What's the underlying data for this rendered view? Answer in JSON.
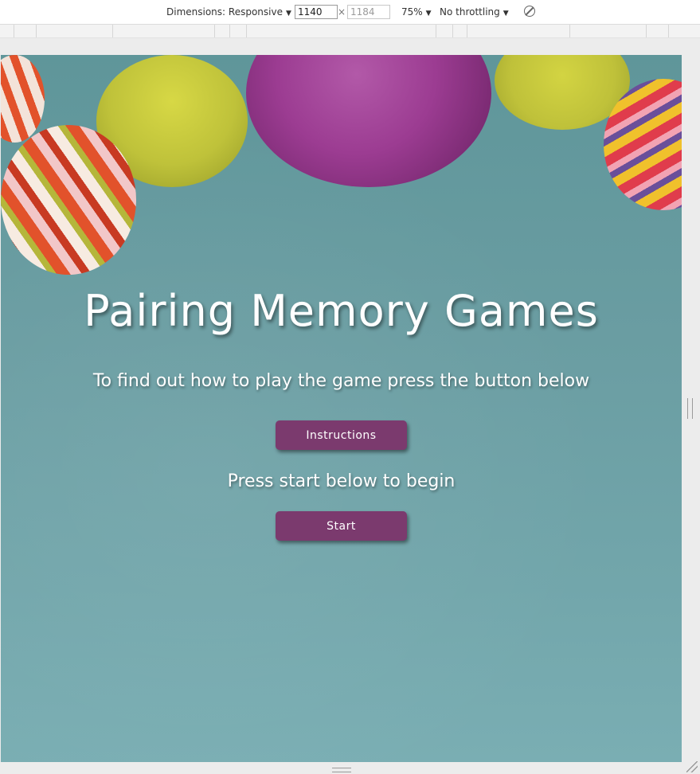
{
  "devtools": {
    "dimensions_label": "Dimensions: Responsive",
    "width_value": "1140",
    "times": "×",
    "height_value": "1184",
    "zoom": "75%",
    "throttling": "No throttling"
  },
  "page": {
    "title": "Pairing Memory Games",
    "subtitle": "To find out how to play the game press the button below",
    "instructions_label": "Instructions",
    "press_start_text": "Press start below to begin",
    "start_label": "Start"
  },
  "colors": {
    "button": "#7b3a6e",
    "background": "#6a9da2"
  }
}
